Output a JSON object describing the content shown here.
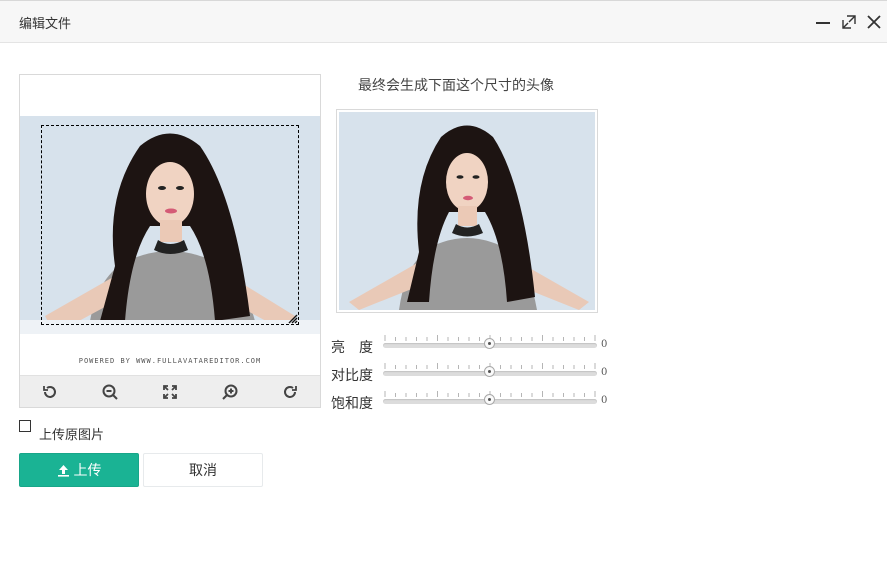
{
  "window": {
    "title": "编辑文件",
    "controls": [
      "minimize-icon",
      "maximize-icon",
      "close-icon"
    ]
  },
  "editor": {
    "powered_by": "POWERED BY WWW.FULLAVATAREDITOR.COM",
    "tools": [
      "rotate-left-icon",
      "zoom-out-icon",
      "fit-screen-icon",
      "zoom-in-icon",
      "rotate-right-icon"
    ]
  },
  "preview": {
    "hint": "最终会生成下面这个尺寸的头像"
  },
  "adjustments": [
    {
      "label": "亮　度",
      "value": "0",
      "level": 0.5
    },
    {
      "label": "对比度",
      "value": "0",
      "level": 0.5
    },
    {
      "label": "饱和度",
      "value": "0",
      "level": 0.5
    }
  ],
  "upload_original": {
    "label": "上传原图片",
    "checked": false
  },
  "buttons": {
    "upload": "上传",
    "cancel": "取消"
  },
  "colors": {
    "primary": "#1ab394",
    "photo_bg": "#d7e2ec"
  }
}
